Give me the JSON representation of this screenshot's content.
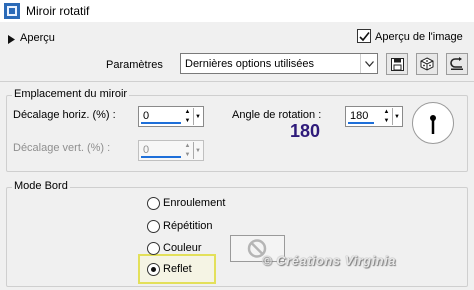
{
  "window": {
    "title": "Miroir rotatif"
  },
  "header": {
    "preview_label": "Aperçu",
    "preview_image_label": "Aperçu de l'image",
    "preview_image_checked": true
  },
  "settings": {
    "label": "Paramètres",
    "selected": "Dernières options utilisées"
  },
  "mirror_location": {
    "title": "Emplacement du miroir",
    "horiz_label": "Décalage horiz. (%) :",
    "horiz_value": "0",
    "vert_label": "Décalage vert. (%) :",
    "vert_value": "0",
    "angle_label": "Angle de rotation :",
    "angle_value": "180",
    "angle_display": "180"
  },
  "edge_mode": {
    "title": "Mode Bord",
    "options": [
      {
        "label": "Enroulement",
        "selected": false
      },
      {
        "label": "Répétition",
        "selected": false
      },
      {
        "label": "Couleur",
        "selected": false
      },
      {
        "label": "Reflet",
        "selected": true
      }
    ]
  },
  "watermark": "© Créations Virginia",
  "colors": {
    "highlight": "#e3e05a",
    "accent": "#1e6fd9",
    "angle_text": "#2e1a7a"
  }
}
